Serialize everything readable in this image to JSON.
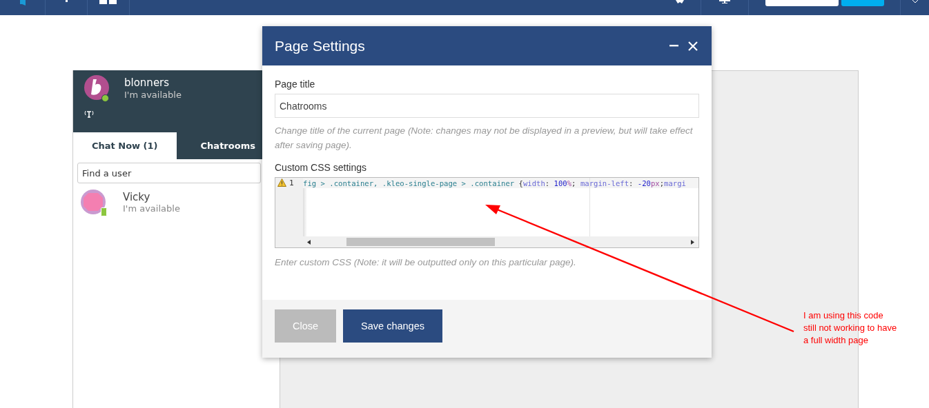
{
  "chat_panel": {
    "user": {
      "name": "blonners",
      "status": "I'm available",
      "online": true
    },
    "tabs": [
      {
        "label": "Chat Now (1)",
        "selected": true
      },
      {
        "label": "Chatrooms",
        "selected": false
      }
    ],
    "search": {
      "placeholder": "Find a user"
    },
    "contacts": [
      {
        "name": "Vicky",
        "status": "I'm available",
        "mobile": true
      }
    ]
  },
  "dialog": {
    "title": "Page Settings",
    "page_title": {
      "label": "Page title",
      "value": "Chatrooms",
      "help": "Change title of the current page (Note: changes may not be displayed in a preview, but will take effect after saving page)."
    },
    "custom_css": {
      "label": "Custom CSS settings",
      "line_number": "1",
      "warning": true,
      "tokens": [
        {
          "kind": "selector",
          "text": "fig > .container, .kleo-single-page > .container "
        },
        {
          "kind": "punct",
          "text": "{"
        },
        {
          "kind": "property",
          "text": "width"
        },
        {
          "kind": "punct",
          "text": ": "
        },
        {
          "kind": "number",
          "text": "100"
        },
        {
          "kind": "unit",
          "text": "%"
        },
        {
          "kind": "punct",
          "text": "; "
        },
        {
          "kind": "property",
          "text": "margin-left"
        },
        {
          "kind": "punct",
          "text": ": "
        },
        {
          "kind": "number",
          "text": "-20"
        },
        {
          "kind": "unit",
          "text": "px"
        },
        {
          "kind": "punct",
          "text": ";"
        },
        {
          "kind": "property",
          "text": "margi"
        }
      ],
      "help": "Enter custom CSS (Note: it will be outputted only on this particular page)."
    },
    "buttons": [
      {
        "label": "Close",
        "kind": "secondary"
      },
      {
        "label": "Save changes",
        "kind": "primary"
      }
    ]
  },
  "annotation": {
    "lines": [
      "I am using this code",
      "still not working to have",
      "a full width page"
    ]
  }
}
